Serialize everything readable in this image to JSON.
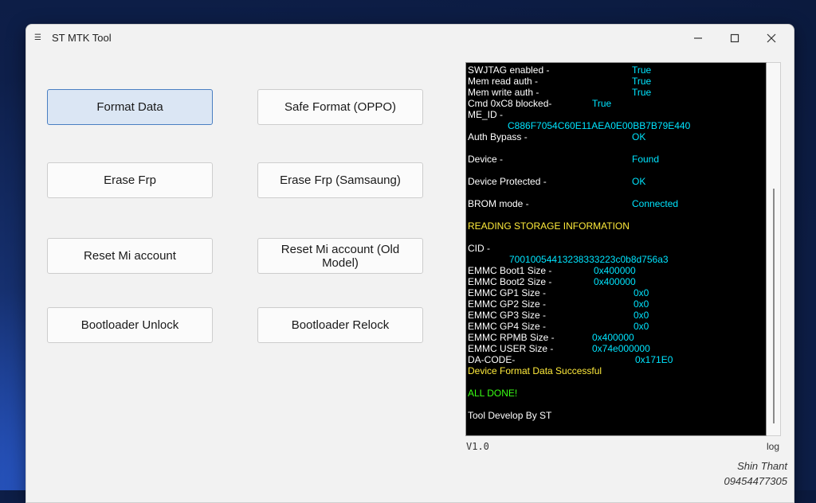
{
  "window": {
    "title": "ST MTK Tool",
    "icon": "app-icon"
  },
  "buttons": [
    {
      "label": "Format Data"
    },
    {
      "label": "Safe Format (OPPO)"
    },
    {
      "label": "Erase Frp"
    },
    {
      "label": "Erase Frp (Samsaung)"
    },
    {
      "label": "Reset Mi account"
    },
    {
      "label": "Reset Mi account (Old Model)"
    },
    {
      "label": "Bootloader Unlock"
    },
    {
      "label": "Bootloader Relock"
    }
  ],
  "log": [
    {
      "label": "SWJTAG enabled -",
      "value": "True",
      "color": "cyan"
    },
    {
      "label": "Mem read auth -",
      "value": "True",
      "color": "cyan"
    },
    {
      "label": "Mem write auth -",
      "value": "True",
      "color": "cyan"
    },
    {
      "label": "Cmd 0xC8 blocked-",
      "value": "True",
      "color": "cyan"
    },
    {
      "label": "ME_ID -",
      "value": "",
      "color": "cyan"
    },
    {
      "label": "",
      "value": "C886F7054C60E11AEA0E00BB7B79E440",
      "color": "cyan"
    },
    {
      "label": "Auth Bypass -",
      "value": "OK",
      "color": "cyan"
    },
    {
      "label": "Device -",
      "value": "Found",
      "color": "cyan"
    },
    {
      "label": "Device Protected -",
      "value": "OK",
      "color": "cyan"
    },
    {
      "label": "BROM mode -",
      "value": "Connected",
      "color": "cyan"
    },
    {
      "label": "READING STORAGE INFORMATION",
      "value": "",
      "color": "yellow"
    },
    {
      "label": "CID -",
      "value": "",
      "color": "cyan"
    },
    {
      "label": "",
      "value": "70010054413238333223c0b8d756a3",
      "color": "cyan"
    },
    {
      "label": "EMMC Boot1 Size -",
      "value": "0x400000",
      "color": "cyan"
    },
    {
      "label": "EMMC Boot2 Size -",
      "value": "0x400000",
      "color": "cyan"
    },
    {
      "label": "EMMC GP1 Size -",
      "value": "0x0",
      "color": "cyan"
    },
    {
      "label": "EMMC GP2 Size -",
      "value": "0x0",
      "color": "cyan"
    },
    {
      "label": "EMMC GP3 Size -",
      "value": "0x0",
      "color": "cyan"
    },
    {
      "label": "EMMC GP4 Size -",
      "value": "0x0",
      "color": "cyan"
    },
    {
      "label": "EMMC RPMB Size -",
      "value": "0x400000",
      "color": "cyan"
    },
    {
      "label": "EMMC USER Size -",
      "value": "0x74e000000",
      "color": "cyan"
    },
    {
      "label": "DA-CODE-",
      "value": "0x171E0",
      "color": "cyan"
    },
    {
      "label": "Device Format Data Successful",
      "value": "",
      "color": "yellow"
    },
    {
      "label": "ALL DONE!",
      "value": "",
      "color": "green"
    },
    {
      "label": "Tool Develop By ST",
      "value": "",
      "color": "white"
    }
  ],
  "footer": {
    "version": "V1.0",
    "log_label": "log"
  },
  "credit": {
    "name": "Shin Thant",
    "phone": "09454477305"
  },
  "colors": {
    "cyan": "#00e5ff",
    "yellow": "#ffeb3b",
    "green": "#39ff14",
    "accent": "#4a7fc2"
  }
}
